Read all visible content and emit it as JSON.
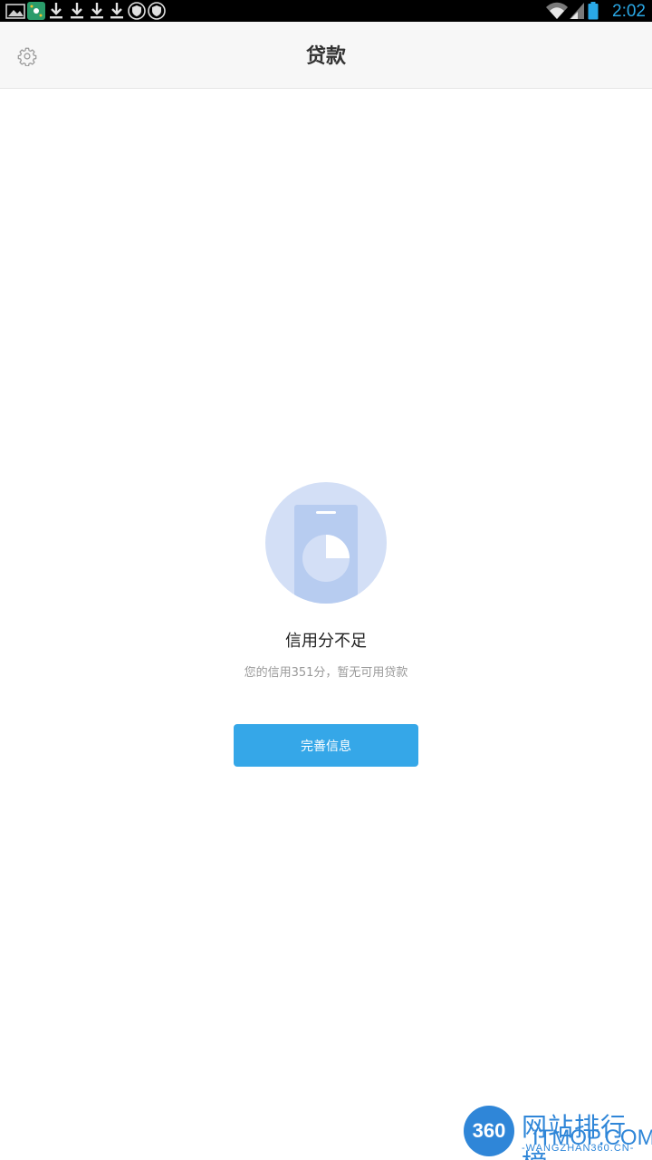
{
  "status_bar": {
    "time": "2:02",
    "left_icons": [
      "image-icon",
      "app-icon",
      "download-icon",
      "download-icon",
      "download-icon",
      "download-icon",
      "shield-icon",
      "shield-icon"
    ],
    "right_icons": [
      "wifi-icon",
      "signal-icon",
      "battery-icon"
    ]
  },
  "header": {
    "title": "贷款",
    "settings_icon": "gear-icon"
  },
  "empty_state": {
    "illustration": "credit-card-pie-icon",
    "title": "信用分不足",
    "description": "您的信用351分，暂无可用贷款",
    "button_label": "完善信息"
  },
  "colors": {
    "accent": "#35a7e8",
    "header_bg": "#f7f7f7",
    "illustration_circle": "#d3dff6",
    "illustration_card": "#b7ccf0"
  },
  "watermark": {
    "badge": "360",
    "cn_text": "网站排行榜",
    "domain": "ITMOP.COM",
    "sub": "-WANGZHAN360.CN-"
  }
}
